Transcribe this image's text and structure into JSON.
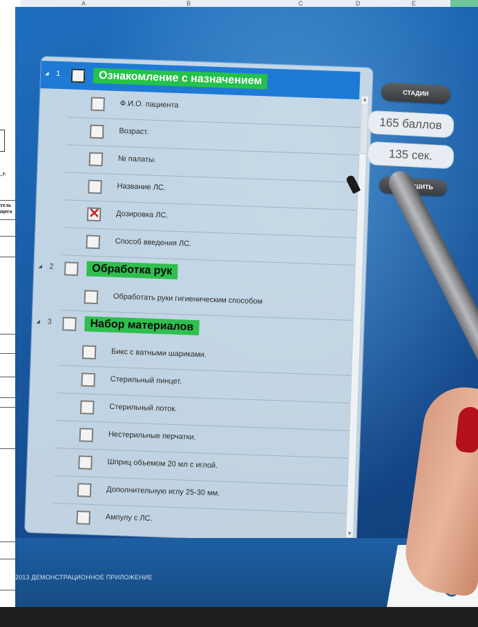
{
  "spreadsheet": {
    "column_headers": [
      "A",
      "B",
      "C",
      "D",
      "E"
    ],
    "fragment_1": "_г.",
    "fragment_2": "тель",
    "fragment_3": "щего"
  },
  "app": {
    "caption": "2013 ДЕМОНСТРАЦИОННОЕ ПРИЛОЖЕНИЕ",
    "accent_color": "#1f7ad6",
    "section_color": "#2fbf4f"
  },
  "controls": {
    "stages_label": "СТАДИИ",
    "score": "165 баллов",
    "time": "135 сек.",
    "finish_label": "ЗАВЕРШИТЬ"
  },
  "checklist": {
    "sections": [
      {
        "number": "1",
        "title": "Ознакомление с назначением",
        "items": [
          {
            "label": "Ф.И.О. пациента",
            "checked": false
          },
          {
            "label": "Возраст.",
            "checked": false
          },
          {
            "label": "№ палаты.",
            "checked": false
          },
          {
            "label": "Название ЛС.",
            "checked": false
          },
          {
            "label": "Дозировка ЛС.",
            "checked": true
          },
          {
            "label": "Способ введения ЛС.",
            "checked": false
          }
        ]
      },
      {
        "number": "2",
        "title": "Обработка рук",
        "items": [
          {
            "label": "Обработать руки гигиеническим способом",
            "checked": false
          }
        ]
      },
      {
        "number": "3",
        "title": "Набор материалов",
        "items": [
          {
            "label": "Бикс с ватными шариками.",
            "checked": false
          },
          {
            "label": "Стерильный пинцет.",
            "checked": false
          },
          {
            "label": "Стерильный лоток.",
            "checked": false
          },
          {
            "label": "Нестерильные перчатки.",
            "checked": false
          },
          {
            "label": "Шприц объемом 20 мл с иглой.",
            "checked": false
          },
          {
            "label": "Дополнительную иглу 25-30 мм.",
            "checked": false
          },
          {
            "label": "Ампулу с ЛС.",
            "checked": false
          }
        ]
      }
    ]
  }
}
